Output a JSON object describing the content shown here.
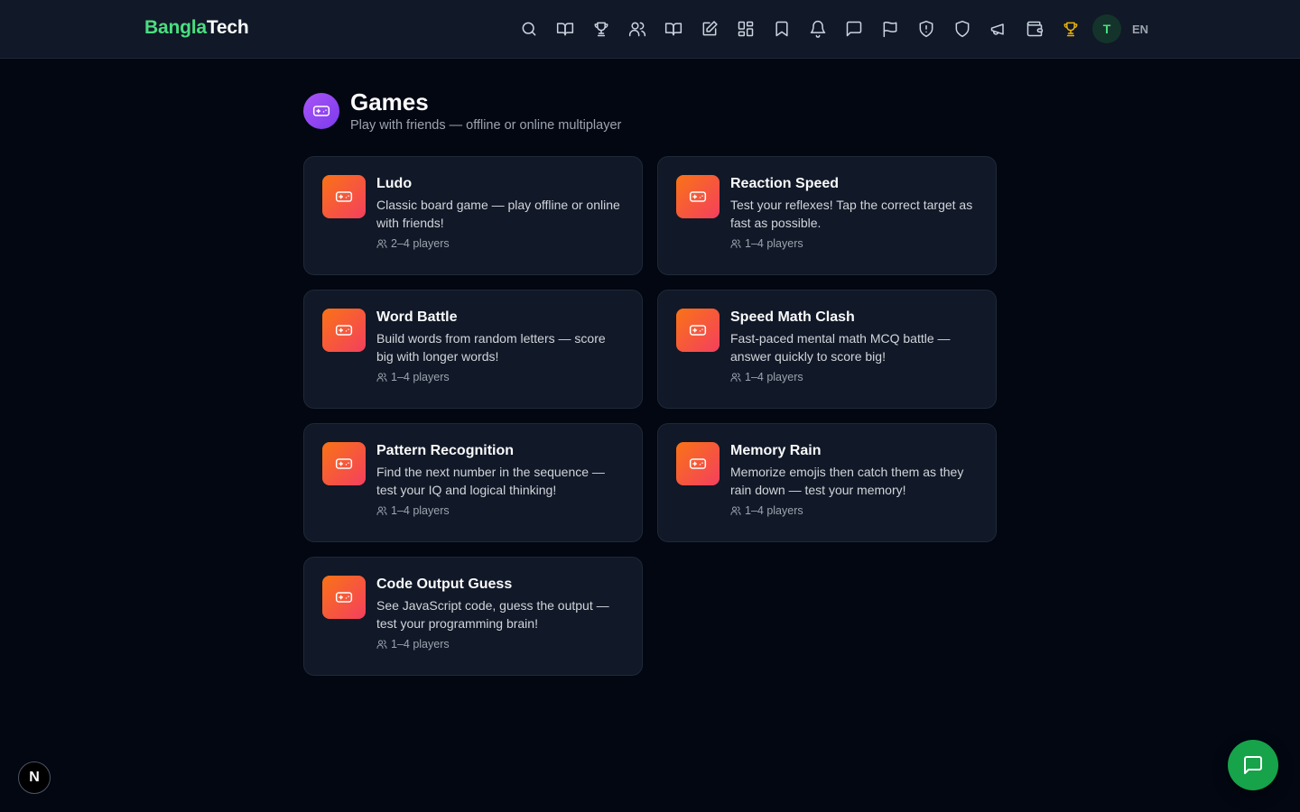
{
  "brand": {
    "part1": "Bangla",
    "part2": "Tech"
  },
  "nav": {
    "icons": [
      "search-icon",
      "book-open-icon",
      "trophy-icon",
      "users-icon",
      "book-icon",
      "edit-icon",
      "grid-icon",
      "bookmark-icon",
      "bell-icon",
      "message-icon",
      "flag-icon",
      "shield-alert-icon",
      "shield-icon",
      "megaphone-icon",
      "wallet-icon",
      "trophy-icon"
    ],
    "active_icon": "trophy-icon",
    "avatar_initial": "T",
    "language": "EN"
  },
  "page": {
    "title": "Games",
    "subtitle": "Play with friends — offline or online multiplayer"
  },
  "games": [
    {
      "title": "Ludo",
      "description": "Classic board game — play offline or online with friends!",
      "players": "2–4 players"
    },
    {
      "title": "Reaction Speed",
      "description": "Test your reflexes! Tap the correct target as fast as possible.",
      "players": "1–4 players"
    },
    {
      "title": "Word Battle",
      "description": "Build words from random letters — score big with longer words!",
      "players": "1–4 players"
    },
    {
      "title": "Speed Math Clash",
      "description": "Fast-paced mental math MCQ battle — answer quickly to score big!",
      "players": "1–4 players"
    },
    {
      "title": "Pattern Recognition",
      "description": "Find the next number in the sequence — test your IQ and logical thinking!",
      "players": "1–4 players"
    },
    {
      "title": "Memory Rain",
      "description": "Memorize emojis then catch them as they rain down — test your memory!",
      "players": "1–4 players"
    },
    {
      "title": "Code Output Guess",
      "description": "See JavaScript code, guess the output — test your programming brain!",
      "players": "1–4 players"
    }
  ],
  "next_badge": "N",
  "colors": {
    "brand_green": "#4ade80",
    "active_gold": "#eab308",
    "card_gradient_start": "#f97316",
    "card_gradient_end": "#f43f5e",
    "header_icon": "#8b5cf6",
    "chat_button": "#16a34a"
  }
}
